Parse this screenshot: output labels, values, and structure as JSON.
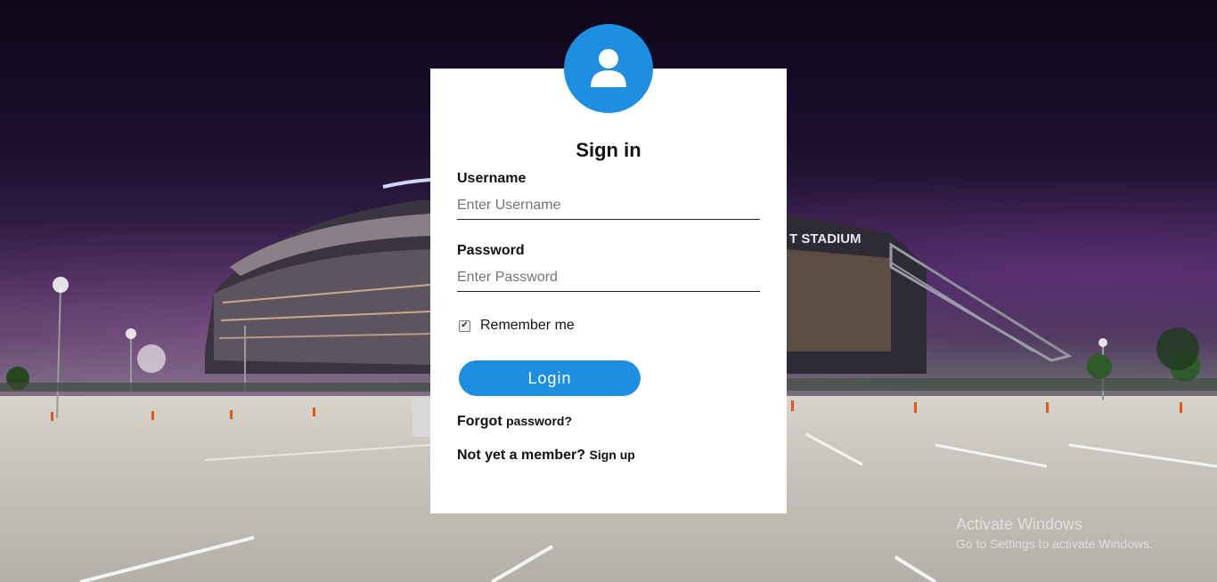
{
  "login_form": {
    "title": "Sign in",
    "username_label": "Username",
    "username_placeholder": "Enter Username",
    "username_value": "",
    "password_label": "Password",
    "password_placeholder": "Enter Password",
    "password_value": "",
    "remember_label": "Remember me",
    "remember_checked": true,
    "login_button": "Login",
    "forgot_prefix": "Forgot",
    "forgot_link": "password?",
    "signup_prefix": "Not yet a member?",
    "signup_link": "Sign up"
  },
  "avatar": {
    "icon": "user-icon",
    "color": "#1e8fe0"
  },
  "background": {
    "subject": "stadium-night-photo",
    "stadium_sign": "T STADIUM"
  },
  "watermark": {
    "line1": "Activate Windows",
    "line2": "Go to Settings to activate Windows."
  },
  "colors": {
    "accent": "#1e8fe0",
    "card": "#ffffff"
  }
}
